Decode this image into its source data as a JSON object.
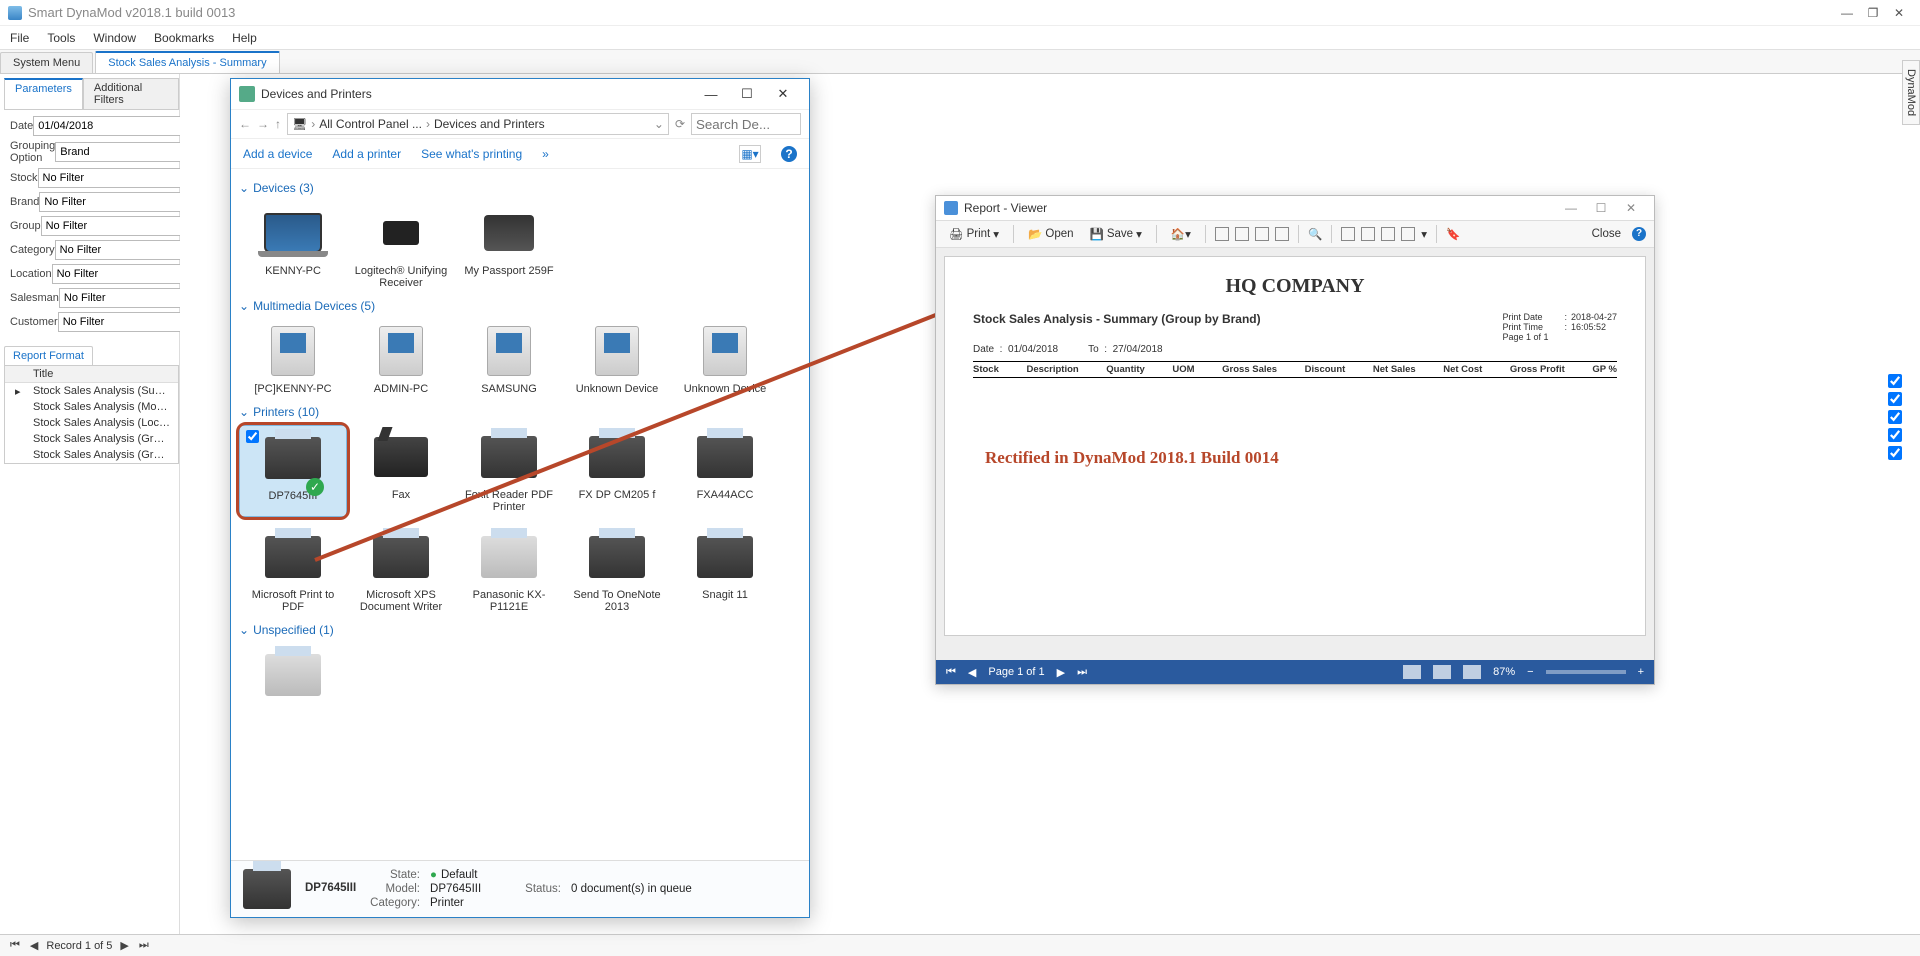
{
  "app": {
    "title": "Smart DynaMod v2018.1 build 0013",
    "menus": [
      "File",
      "Tools",
      "Window",
      "Bookmarks",
      "Help"
    ],
    "tabs": [
      {
        "label": "System Menu"
      },
      {
        "label": "Stock Sales Analysis - Summary",
        "active": true
      }
    ],
    "side_tab_label": "DynaMod"
  },
  "params_panel": {
    "tabs": [
      {
        "label": "Parameters",
        "active": true
      },
      {
        "label": "Additional Filters"
      }
    ],
    "rows": [
      {
        "label": "Date",
        "value": "01/04/2018"
      },
      {
        "label": "Grouping Option",
        "value": "Brand"
      },
      {
        "label": "Stock",
        "value": "No Filter"
      },
      {
        "label": "Brand",
        "value": "No Filter"
      },
      {
        "label": "Group",
        "value": "No Filter"
      },
      {
        "label": "Category",
        "value": "No Filter"
      },
      {
        "label": "Location",
        "value": "No Filter"
      },
      {
        "label": "Salesman",
        "value": "No Filter"
      },
      {
        "label": "Customer",
        "value": "No Filter"
      }
    ]
  },
  "report_format": {
    "header": "Report Format",
    "title_col": "Title",
    "items": [
      "Stock Sales Analysis (Summary)",
      "Stock Sales Analysis (Monthly)",
      "Stock Sales Analysis (Location)",
      "Stock Sales Analysis (Grouping vs Monthly)",
      "Stock Sales Analysis (Grouping vs Location)"
    ]
  },
  "status": {
    "record": "Record 1 of 5"
  },
  "devices_window": {
    "title": "Devices and Printers",
    "breadcrumb": [
      "All Control Panel ...",
      "Devices and Printers"
    ],
    "search_placeholder": "Search De...",
    "toolbar": [
      "Add a device",
      "Add a printer",
      "See what's printing",
      "»"
    ],
    "groups": {
      "devices": {
        "label": "Devices (3)",
        "items": [
          "KENNY-PC",
          "Logitech® Unifying Receiver",
          "My Passport 259F"
        ]
      },
      "multimedia": {
        "label": "Multimedia Devices (5)",
        "items": [
          "[PC]KENNY-PC",
          "ADMIN-PC",
          "SAMSUNG",
          "Unknown Device",
          "Unknown Device"
        ]
      },
      "printers": {
        "label": "Printers (10)",
        "items": [
          "DP7645III",
          "Fax",
          "Foxit Reader PDF Printer",
          "FX DP CM205 f",
          "FXA44ACC",
          "Microsoft Print to PDF",
          "Microsoft XPS Document Writer",
          "Panasonic KX-P1121E",
          "Send To OneNote 2013",
          "Snagit 11"
        ]
      },
      "unspecified": {
        "label": "Unspecified (1)"
      }
    },
    "details": {
      "name": "DP7645III",
      "state_label": "State:",
      "state_value": "Default",
      "model_label": "Model:",
      "model_value": "DP7645III",
      "category_label": "Category:",
      "category_value": "Printer",
      "status_label": "Status:",
      "status_value": "0 document(s) in queue"
    }
  },
  "report_viewer": {
    "title": "Report - Viewer",
    "toolbar": {
      "print": "Print",
      "open": "Open",
      "save": "Save",
      "close": "Close"
    },
    "page": {
      "company": "HQ COMPANY",
      "report_title": "Stock Sales Analysis - Summary (Group by Brand)",
      "print_date_label": "Print Date",
      "print_date": "2018-04-27",
      "print_time_label": "Print Time",
      "print_time": "16:05:52",
      "page_info": "Page 1 of 1",
      "date_from_label": "Date",
      "date_from": "01/04/2018",
      "date_to_label": "To",
      "date_to": "27/04/2018",
      "columns": [
        "Stock",
        "Description",
        "Quantity",
        "UOM",
        "Gross Sales",
        "Discount",
        "Net Sales",
        "Net Cost",
        "Gross Profit",
        "GP %"
      ],
      "annotation": "Rectified in DynaMod 2018.1 Build 0014"
    },
    "status": {
      "page": "Page 1 of 1",
      "zoom": "87%"
    }
  }
}
